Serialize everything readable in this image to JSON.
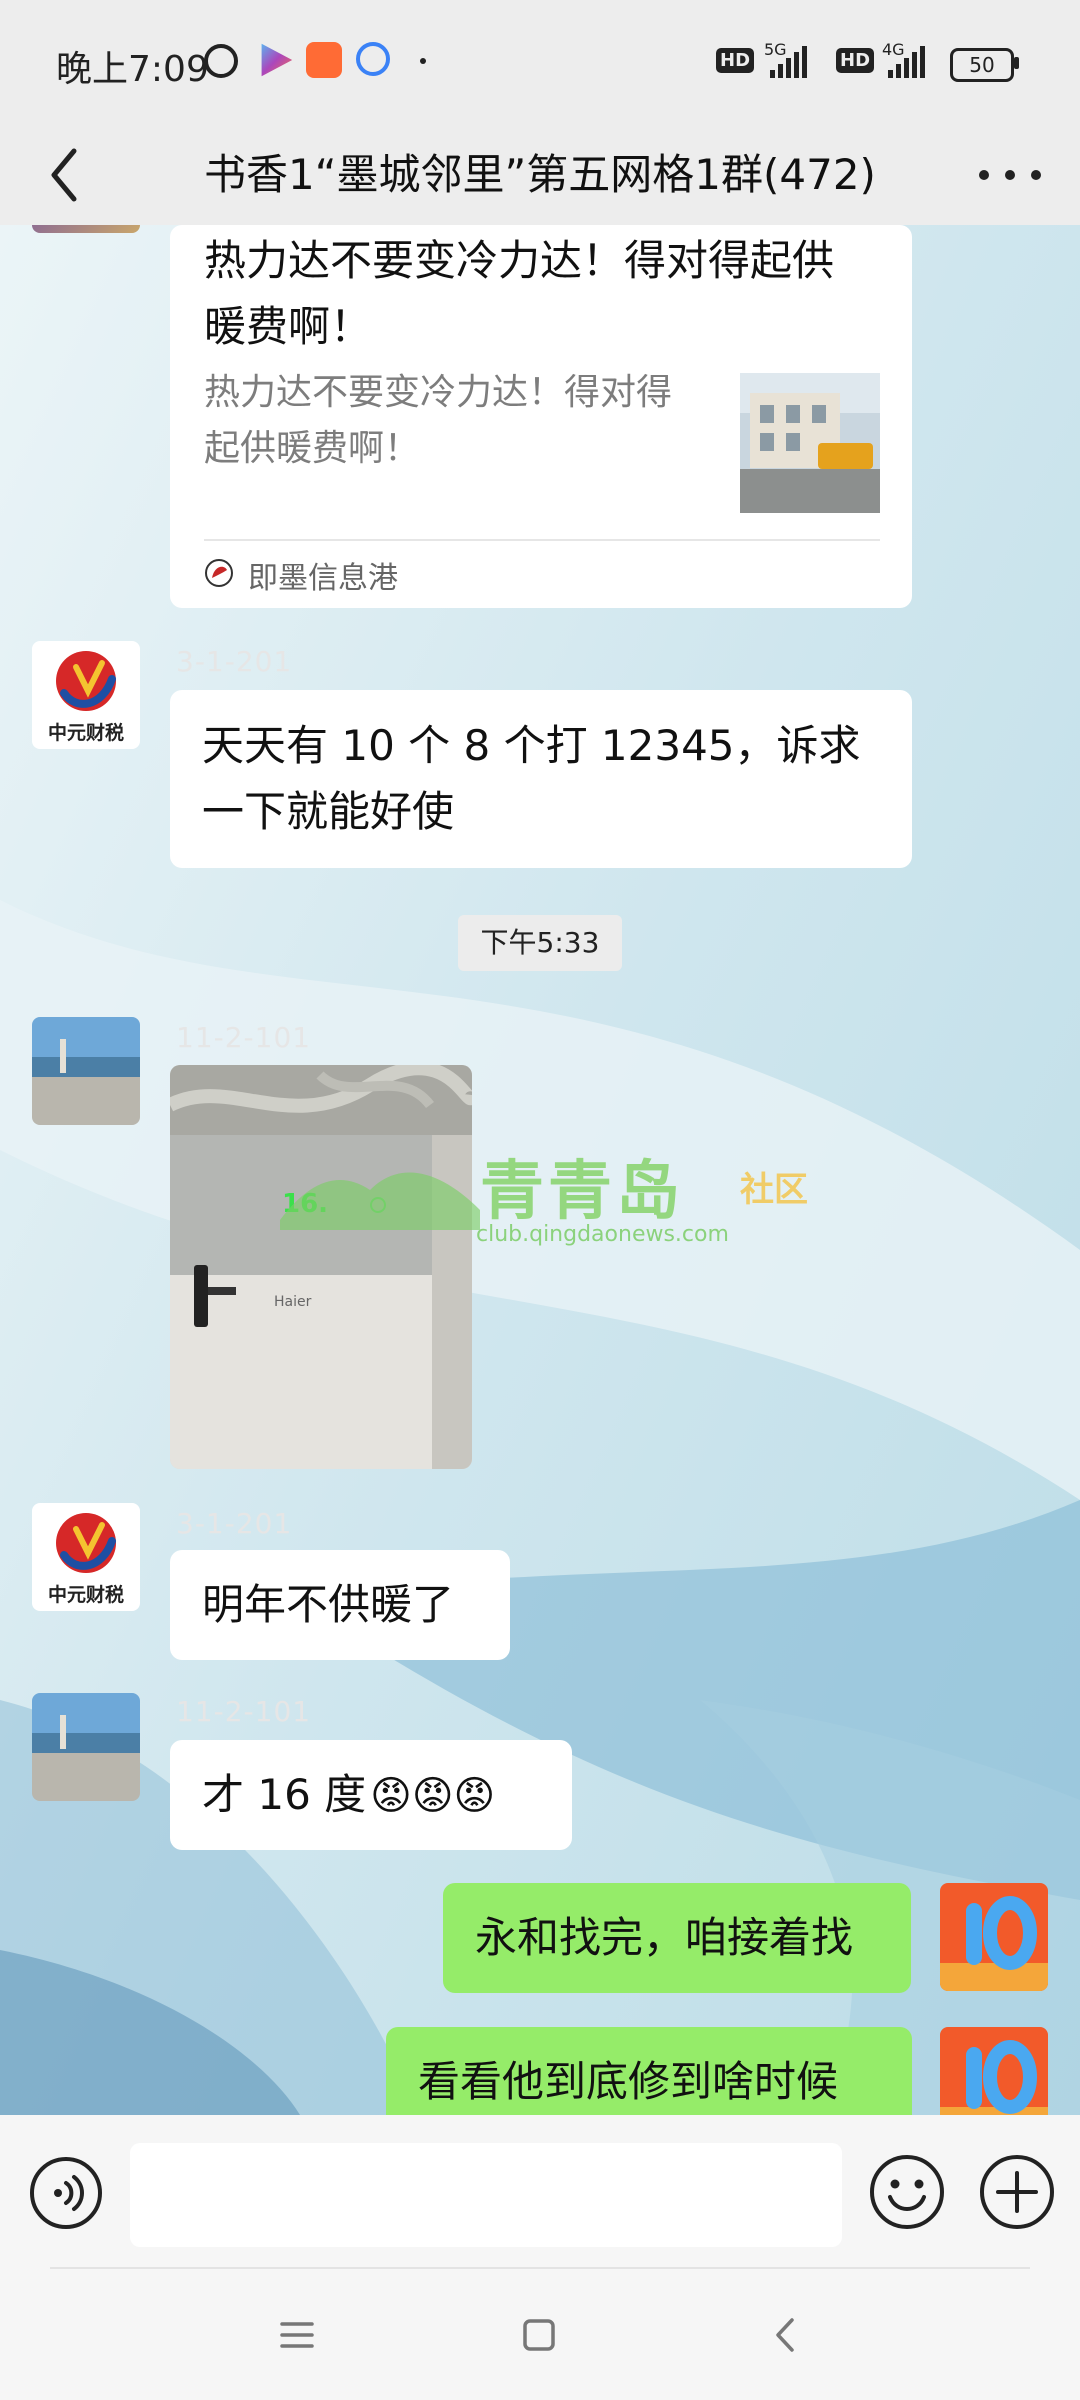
{
  "status_bar": {
    "time": "晚上7:09",
    "hd_1": "HD",
    "net_1": "5G",
    "hd_2": "HD",
    "net_2": "4G",
    "battery": "50"
  },
  "header": {
    "title": "书香1“墨城邻里”第五网格1群(472)",
    "back_icon": "chevron-left-icon",
    "more_icon": "more-dots-icon"
  },
  "link_card": {
    "title": "热力达不要变冷力达！得对得起供暖费啊！",
    "description": "热力达不要变冷力达！得对得起供暖费啊！",
    "source": "即墨信息港"
  },
  "messages": [
    {
      "sender": "3-1-201",
      "avatar_text": "中元财税",
      "text": "天天有 10 个 8 个打 12345，诉求一下就能好使"
    },
    {
      "time": "下午5:33"
    },
    {
      "sender": "11-2-101",
      "type": "image"
    },
    {
      "sender": "3-1-201",
      "avatar_text": "中元财税",
      "text": "明年不供暖了"
    },
    {
      "sender": "11-2-101",
      "text": "才 16 度",
      "emoji": "😡😡😡"
    },
    {
      "self": true,
      "text": "永和找完，咱接着找"
    },
    {
      "self": true,
      "text": "看看他到底修到啥时候"
    }
  ],
  "photo": {
    "display_reading": "16.",
    "brand": "Haier"
  },
  "watermark": {
    "name": "青青岛",
    "tag": "社区",
    "url": "club.qingdaonews.com"
  },
  "input_bar": {
    "voice_icon": "voice-icon",
    "emoji_icon": "emoji-icon",
    "plus_icon": "plus-icon"
  },
  "nav_bar": {
    "menu_icon": "menu-icon",
    "home_icon": "home-icon",
    "back_icon": "back-icon"
  },
  "colors": {
    "self_bubble": "#95ec69",
    "bubble": "#ffffff",
    "bar": "#ededed"
  }
}
